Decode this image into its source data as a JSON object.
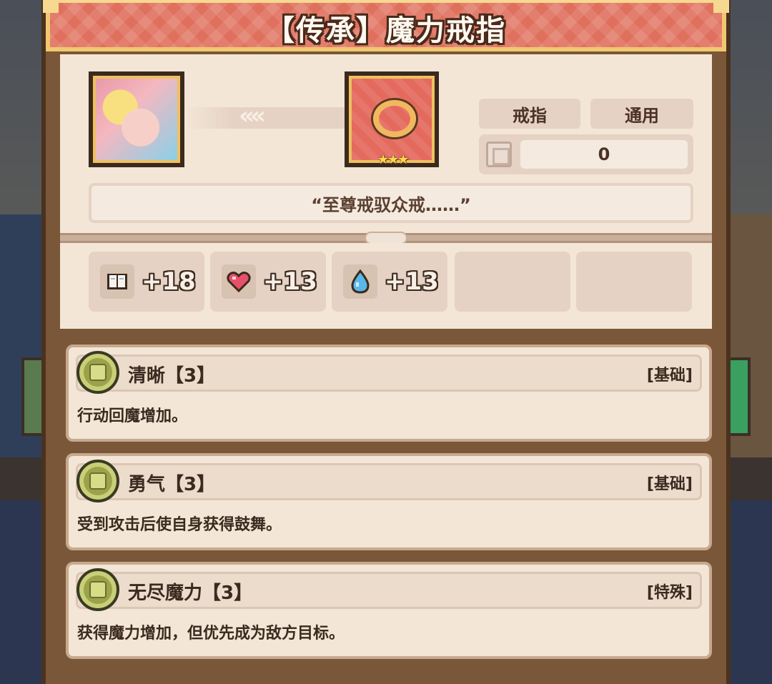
{
  "title": "【传承】魔力戒指",
  "item": {
    "type_tag": "戒指",
    "class_tag": "通用",
    "count": "0",
    "quote": "“至尊戒驭众戒……”",
    "stars": "★★★"
  },
  "stats": [
    {
      "icon": "book-icon",
      "value": "+18"
    },
    {
      "icon": "heart-icon",
      "value": "+13"
    },
    {
      "icon": "water-drop-icon",
      "value": "+13"
    }
  ],
  "skills": [
    {
      "name": "清晰【3】",
      "type": "[基础]",
      "desc": "行动回魔增加。",
      "medal_color": "#9aa24a"
    },
    {
      "name": "勇气【3】",
      "type": "[基础]",
      "desc": "受到攻击后使自身获得鼓舞。",
      "medal_color": "#9aa24a"
    },
    {
      "name": "无尽魔力【3】",
      "type": "[特殊]",
      "desc": "获得魔力增加，但优先成为敌方目标。",
      "medal_color": "#9aa24a"
    }
  ]
}
